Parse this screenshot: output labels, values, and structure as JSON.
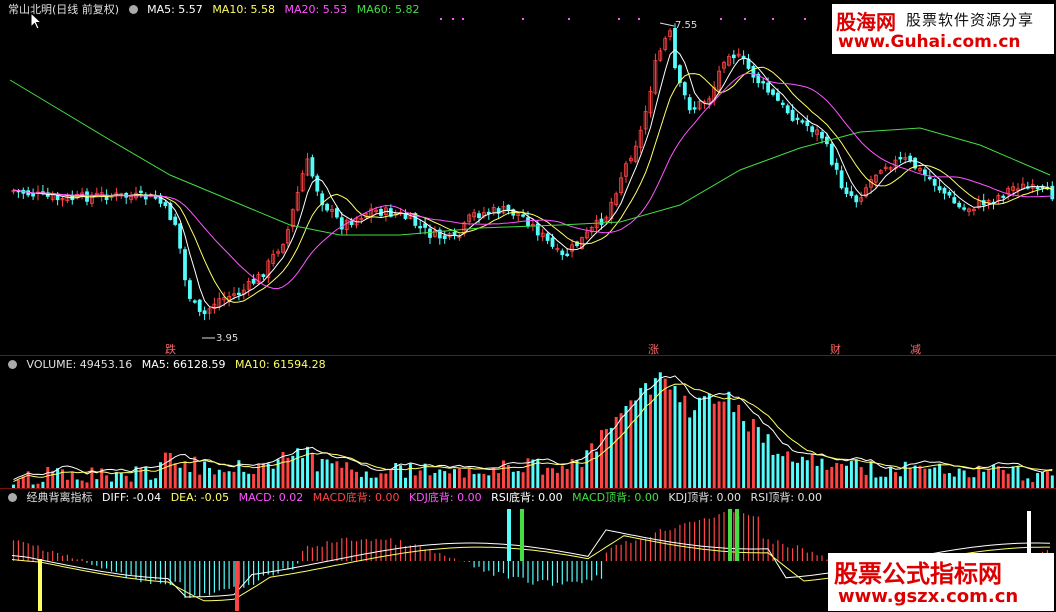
{
  "main_panel": {
    "title": "常山北明(日线 前复权)",
    "ma5": "MA5: 5.57",
    "ma10": "MA10: 5.58",
    "ma20": "MA20: 5.53",
    "ma60": "MA60: 5.82",
    "high_label": "7.55",
    "low_label": "3.95",
    "markers": [
      "跌",
      "涨",
      "财",
      "减"
    ]
  },
  "volume_panel": {
    "volume": "VOLUME: 49453.16",
    "ma5": "MA5: 66128.59",
    "ma10": "MA10: 61594.28"
  },
  "indicator_panel": {
    "name": "经典背离指标",
    "diff": "DIFF: -0.04",
    "dea": "DEA: -0.05",
    "macd": "MACD: 0.02",
    "macd_bottom": "MACD底背: 0.00",
    "kdj_bottom": "KDJ底背: 0.00",
    "rsi_bottom": "RSI底背: 0.00",
    "macd_top": "MACD顶背: 0.00",
    "kdj_top": "KDJ顶背: 0.00",
    "rsi_top": "RSI顶背: 0.00"
  },
  "watermarks": {
    "top_brand": "股海网",
    "top_tag": "股票软件资源分享",
    "top_url": "www.Guhai.com.cn",
    "bottom_brand": "股票公式指标网",
    "bottom_url": "www.gszx.com.cn"
  },
  "colors": {
    "up": "#ff4444",
    "down": "#54fcfc",
    "ma5": "#ffffff",
    "ma10": "#ffff66",
    "ma20": "#ff55ff",
    "ma60": "#44dd44"
  }
}
